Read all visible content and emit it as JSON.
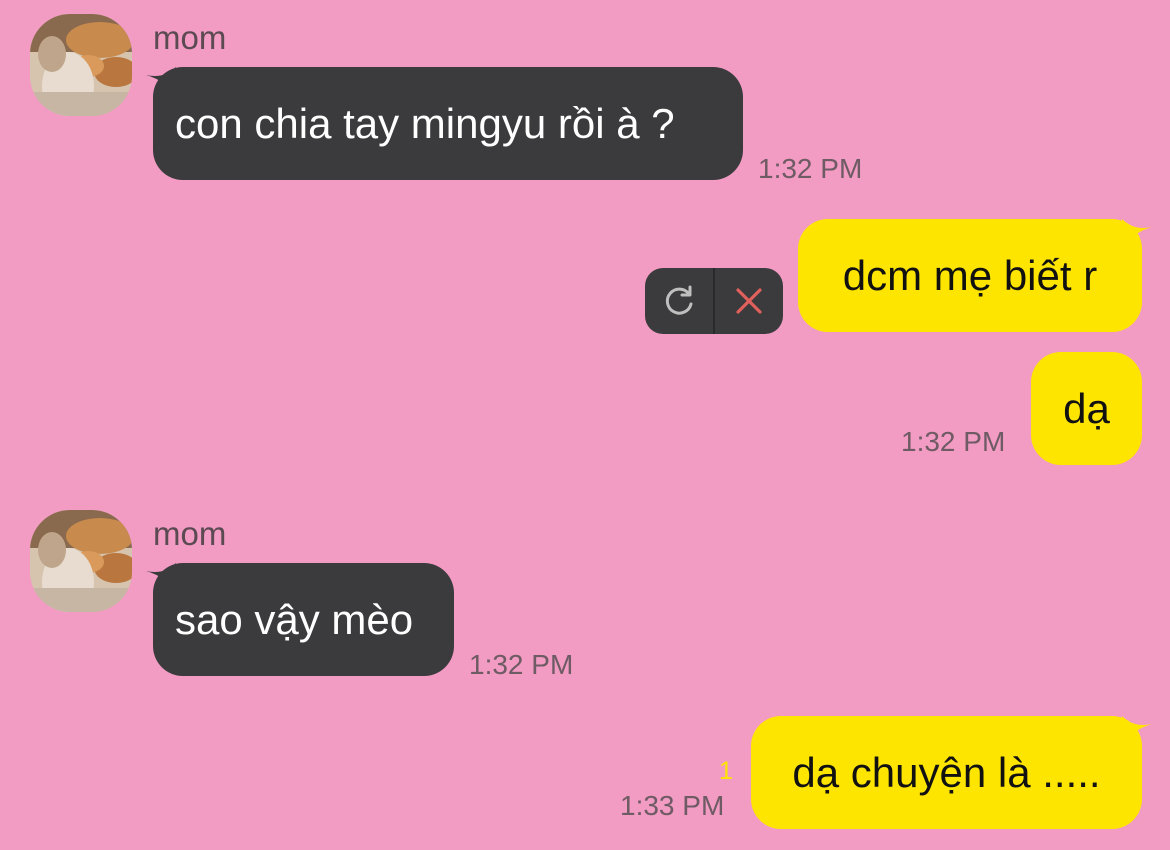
{
  "messages": [
    {
      "sender": "mom",
      "text": "con chia tay mingyu rồi à ?",
      "time": "1:32 PM"
    },
    {
      "text": "dcm mẹ biết r"
    },
    {
      "text": "dạ",
      "time": "1:32 PM"
    },
    {
      "sender": "mom",
      "text": "sao vậy mèo",
      "time": "1:32 PM"
    },
    {
      "text": "dạ chuyện là .....",
      "time": "1:33 PM",
      "unread_count": "1"
    }
  ],
  "icons": {
    "retry": "refresh-icon",
    "delete": "close-icon"
  },
  "colors": {
    "background": "#f29bc3",
    "incoming_bubble": "#3b3b3d",
    "outgoing_bubble": "#fee500",
    "delete_icon": "#e0605c"
  }
}
